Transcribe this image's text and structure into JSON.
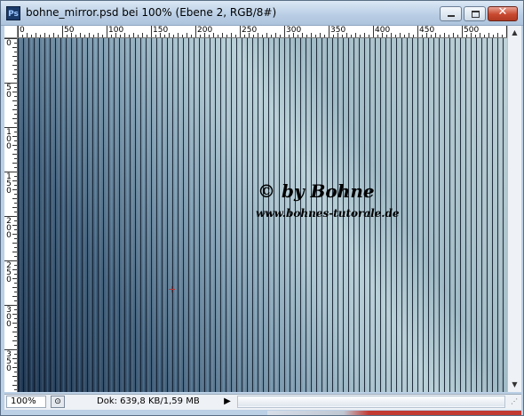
{
  "window": {
    "title": "bohne_mirror.psd bei 100% (Ebene 2, RGB/8#)",
    "app_icon_text": "Ps",
    "close_glyph": "✕"
  },
  "ruler": {
    "h_labels": [
      "0",
      "50",
      "100",
      "150",
      "200",
      "250",
      "300",
      "350",
      "400",
      "450",
      "500"
    ],
    "v_labels": [
      "0",
      "50",
      "100",
      "150",
      "200",
      "250",
      "300",
      "350"
    ]
  },
  "canvas": {
    "watermark_line1": "© by Bohne",
    "watermark_line2": "www.bohnes-tutorale.de",
    "colors": {
      "dark": "#1e3550",
      "mid": "#7e9cb0",
      "light": "#b7ced6",
      "stripe": "#0a1423"
    }
  },
  "status": {
    "zoom": "100%",
    "doc_info": "Dok: 639,8 KB/1,59 MB",
    "play_glyph": "▶"
  },
  "icons": {
    "app": "photoshop-icon",
    "minimize": "minimize-icon",
    "maximize": "maximize-icon",
    "close": "close-icon",
    "scroll_up": "arrow-up-icon",
    "scroll_down": "arrow-down-icon",
    "status_menu": "status-menu-icon",
    "resize": "resize-grip-icon"
  }
}
